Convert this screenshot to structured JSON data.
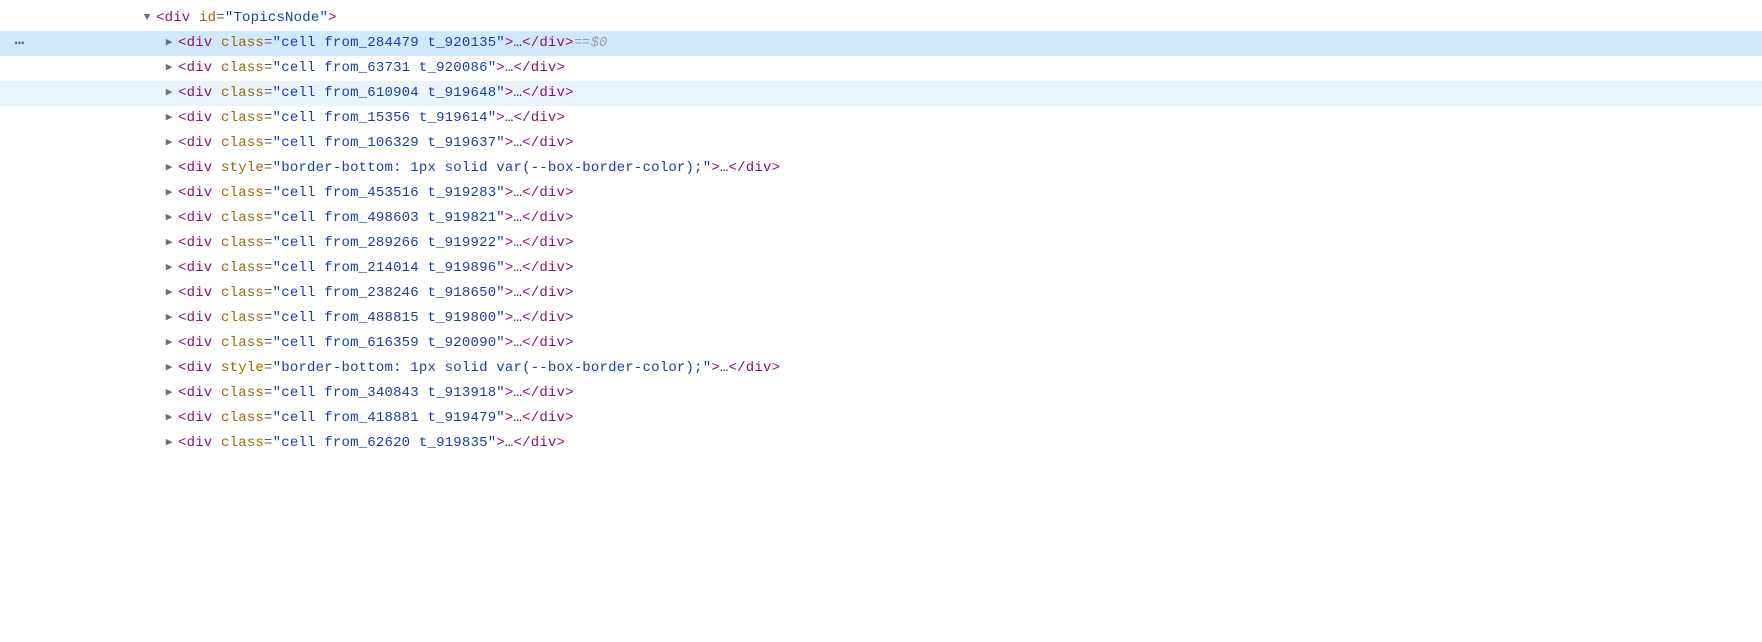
{
  "indent": {
    "base": 100,
    "step": 22
  },
  "glyphs": {
    "right": "▶",
    "down": "▼",
    "ellipsis": "…",
    "gutter_dots": "⋯"
  },
  "suffix": {
    "eqeq": " == ",
    "var": "$0"
  },
  "rows": [
    {
      "depth": 0,
      "arrow": "down",
      "state": "none",
      "gutter": false,
      "tokens": [
        {
          "t": "angle",
          "v": "<"
        },
        {
          "t": "tag",
          "v": "div"
        },
        {
          "t": "space"
        },
        {
          "t": "attr",
          "v": "id"
        },
        {
          "t": "eq",
          "v": "="
        },
        {
          "t": "str",
          "v": "\"TopicsNode\""
        },
        {
          "t": "angle",
          "v": ">"
        }
      ]
    },
    {
      "depth": 1,
      "arrow": "right",
      "state": "selected",
      "gutter": true,
      "suffix": true,
      "tokens": [
        {
          "t": "angle",
          "v": "<"
        },
        {
          "t": "tag",
          "v": "div"
        },
        {
          "t": "space"
        },
        {
          "t": "attr",
          "v": "class"
        },
        {
          "t": "eq",
          "v": "="
        },
        {
          "t": "str",
          "v": "\"cell from_284479 t_920135\""
        },
        {
          "t": "angle",
          "v": ">"
        },
        {
          "t": "ell"
        },
        {
          "t": "angle",
          "v": "</"
        },
        {
          "t": "tag",
          "v": "div"
        },
        {
          "t": "angle",
          "v": ">"
        }
      ]
    },
    {
      "depth": 1,
      "arrow": "right",
      "state": "none",
      "tokens": [
        {
          "t": "angle",
          "v": "<"
        },
        {
          "t": "tag",
          "v": "div"
        },
        {
          "t": "space"
        },
        {
          "t": "attr",
          "v": "class"
        },
        {
          "t": "eq",
          "v": "="
        },
        {
          "t": "str",
          "v": "\"cell from_63731 t_920086\""
        },
        {
          "t": "angle",
          "v": ">"
        },
        {
          "t": "ell"
        },
        {
          "t": "angle",
          "v": "</"
        },
        {
          "t": "tag",
          "v": "div"
        },
        {
          "t": "angle",
          "v": ">"
        }
      ]
    },
    {
      "depth": 1,
      "arrow": "right",
      "state": "hover",
      "tokens": [
        {
          "t": "angle",
          "v": "<"
        },
        {
          "t": "tag",
          "v": "div"
        },
        {
          "t": "space"
        },
        {
          "t": "attr",
          "v": "class"
        },
        {
          "t": "eq",
          "v": "="
        },
        {
          "t": "str",
          "v": "\"cell from_610904 t_919648\""
        },
        {
          "t": "angle",
          "v": ">"
        },
        {
          "t": "ell"
        },
        {
          "t": "angle",
          "v": "</"
        },
        {
          "t": "tag",
          "v": "div"
        },
        {
          "t": "angle",
          "v": ">"
        }
      ]
    },
    {
      "depth": 1,
      "arrow": "right",
      "state": "none",
      "tokens": [
        {
          "t": "angle",
          "v": "<"
        },
        {
          "t": "tag",
          "v": "div"
        },
        {
          "t": "space"
        },
        {
          "t": "attr",
          "v": "class"
        },
        {
          "t": "eq",
          "v": "="
        },
        {
          "t": "str",
          "v": "\"cell from_15356 t_919614\""
        },
        {
          "t": "angle",
          "v": ">"
        },
        {
          "t": "ell"
        },
        {
          "t": "angle",
          "v": "</"
        },
        {
          "t": "tag",
          "v": "div"
        },
        {
          "t": "angle",
          "v": ">"
        }
      ]
    },
    {
      "depth": 1,
      "arrow": "right",
      "state": "none",
      "tokens": [
        {
          "t": "angle",
          "v": "<"
        },
        {
          "t": "tag",
          "v": "div"
        },
        {
          "t": "space"
        },
        {
          "t": "attr",
          "v": "class"
        },
        {
          "t": "eq",
          "v": "="
        },
        {
          "t": "str",
          "v": "\"cell from_106329 t_919637\""
        },
        {
          "t": "angle",
          "v": ">"
        },
        {
          "t": "ell"
        },
        {
          "t": "angle",
          "v": "</"
        },
        {
          "t": "tag",
          "v": "div"
        },
        {
          "t": "angle",
          "v": ">"
        }
      ]
    },
    {
      "depth": 1,
      "arrow": "right",
      "state": "none",
      "tokens": [
        {
          "t": "angle",
          "v": "<"
        },
        {
          "t": "tag",
          "v": "div"
        },
        {
          "t": "space"
        },
        {
          "t": "attr",
          "v": "style"
        },
        {
          "t": "eq",
          "v": "="
        },
        {
          "t": "str",
          "v": "\"border-bottom: 1px solid var(--box-border-color);\""
        },
        {
          "t": "angle",
          "v": ">"
        },
        {
          "t": "ell"
        },
        {
          "t": "angle",
          "v": "</"
        },
        {
          "t": "tag",
          "v": "div"
        },
        {
          "t": "angle",
          "v": ">"
        }
      ]
    },
    {
      "depth": 1,
      "arrow": "right",
      "state": "none",
      "tokens": [
        {
          "t": "angle",
          "v": "<"
        },
        {
          "t": "tag",
          "v": "div"
        },
        {
          "t": "space"
        },
        {
          "t": "attr",
          "v": "class"
        },
        {
          "t": "eq",
          "v": "="
        },
        {
          "t": "str",
          "v": "\"cell from_453516 t_919283\""
        },
        {
          "t": "angle",
          "v": ">"
        },
        {
          "t": "ell"
        },
        {
          "t": "angle",
          "v": "</"
        },
        {
          "t": "tag",
          "v": "div"
        },
        {
          "t": "angle",
          "v": ">"
        }
      ]
    },
    {
      "depth": 1,
      "arrow": "right",
      "state": "none",
      "tokens": [
        {
          "t": "angle",
          "v": "<"
        },
        {
          "t": "tag",
          "v": "div"
        },
        {
          "t": "space"
        },
        {
          "t": "attr",
          "v": "class"
        },
        {
          "t": "eq",
          "v": "="
        },
        {
          "t": "str",
          "v": "\"cell from_498603 t_919821\""
        },
        {
          "t": "angle",
          "v": ">"
        },
        {
          "t": "ell"
        },
        {
          "t": "angle",
          "v": "</"
        },
        {
          "t": "tag",
          "v": "div"
        },
        {
          "t": "angle",
          "v": ">"
        }
      ]
    },
    {
      "depth": 1,
      "arrow": "right",
      "state": "none",
      "tokens": [
        {
          "t": "angle",
          "v": "<"
        },
        {
          "t": "tag",
          "v": "div"
        },
        {
          "t": "space"
        },
        {
          "t": "attr",
          "v": "class"
        },
        {
          "t": "eq",
          "v": "="
        },
        {
          "t": "str",
          "v": "\"cell from_289266 t_919922\""
        },
        {
          "t": "angle",
          "v": ">"
        },
        {
          "t": "ell"
        },
        {
          "t": "angle",
          "v": "</"
        },
        {
          "t": "tag",
          "v": "div"
        },
        {
          "t": "angle",
          "v": ">"
        }
      ]
    },
    {
      "depth": 1,
      "arrow": "right",
      "state": "none",
      "tokens": [
        {
          "t": "angle",
          "v": "<"
        },
        {
          "t": "tag",
          "v": "div"
        },
        {
          "t": "space"
        },
        {
          "t": "attr",
          "v": "class"
        },
        {
          "t": "eq",
          "v": "="
        },
        {
          "t": "str",
          "v": "\"cell from_214014 t_919896\""
        },
        {
          "t": "angle",
          "v": ">"
        },
        {
          "t": "ell"
        },
        {
          "t": "angle",
          "v": "</"
        },
        {
          "t": "tag",
          "v": "div"
        },
        {
          "t": "angle",
          "v": ">"
        }
      ]
    },
    {
      "depth": 1,
      "arrow": "right",
      "state": "none",
      "tokens": [
        {
          "t": "angle",
          "v": "<"
        },
        {
          "t": "tag",
          "v": "div"
        },
        {
          "t": "space"
        },
        {
          "t": "attr",
          "v": "class"
        },
        {
          "t": "eq",
          "v": "="
        },
        {
          "t": "str",
          "v": "\"cell from_238246 t_918650\""
        },
        {
          "t": "angle",
          "v": ">"
        },
        {
          "t": "ell"
        },
        {
          "t": "angle",
          "v": "</"
        },
        {
          "t": "tag",
          "v": "div"
        },
        {
          "t": "angle",
          "v": ">"
        }
      ]
    },
    {
      "depth": 1,
      "arrow": "right",
      "state": "none",
      "tokens": [
        {
          "t": "angle",
          "v": "<"
        },
        {
          "t": "tag",
          "v": "div"
        },
        {
          "t": "space"
        },
        {
          "t": "attr",
          "v": "class"
        },
        {
          "t": "eq",
          "v": "="
        },
        {
          "t": "str",
          "v": "\"cell from_488815 t_919800\""
        },
        {
          "t": "angle",
          "v": ">"
        },
        {
          "t": "ell"
        },
        {
          "t": "angle",
          "v": "</"
        },
        {
          "t": "tag",
          "v": "div"
        },
        {
          "t": "angle",
          "v": ">"
        }
      ]
    },
    {
      "depth": 1,
      "arrow": "right",
      "state": "none",
      "tokens": [
        {
          "t": "angle",
          "v": "<"
        },
        {
          "t": "tag",
          "v": "div"
        },
        {
          "t": "space"
        },
        {
          "t": "attr",
          "v": "class"
        },
        {
          "t": "eq",
          "v": "="
        },
        {
          "t": "str",
          "v": "\"cell from_616359 t_920090\""
        },
        {
          "t": "angle",
          "v": ">"
        },
        {
          "t": "ell"
        },
        {
          "t": "angle",
          "v": "</"
        },
        {
          "t": "tag",
          "v": "div"
        },
        {
          "t": "angle",
          "v": ">"
        }
      ]
    },
    {
      "depth": 1,
      "arrow": "right",
      "state": "none",
      "tokens": [
        {
          "t": "angle",
          "v": "<"
        },
        {
          "t": "tag",
          "v": "div"
        },
        {
          "t": "space"
        },
        {
          "t": "attr",
          "v": "style"
        },
        {
          "t": "eq",
          "v": "="
        },
        {
          "t": "str",
          "v": "\"border-bottom: 1px solid var(--box-border-color);\""
        },
        {
          "t": "angle",
          "v": ">"
        },
        {
          "t": "ell"
        },
        {
          "t": "angle",
          "v": "</"
        },
        {
          "t": "tag",
          "v": "div"
        },
        {
          "t": "angle",
          "v": ">"
        }
      ]
    },
    {
      "depth": 1,
      "arrow": "right",
      "state": "none",
      "tokens": [
        {
          "t": "angle",
          "v": "<"
        },
        {
          "t": "tag",
          "v": "div"
        },
        {
          "t": "space"
        },
        {
          "t": "attr",
          "v": "class"
        },
        {
          "t": "eq",
          "v": "="
        },
        {
          "t": "str",
          "v": "\"cell from_340843 t_913918\""
        },
        {
          "t": "angle",
          "v": ">"
        },
        {
          "t": "ell"
        },
        {
          "t": "angle",
          "v": "</"
        },
        {
          "t": "tag",
          "v": "div"
        },
        {
          "t": "angle",
          "v": ">"
        }
      ]
    },
    {
      "depth": 1,
      "arrow": "right",
      "state": "none",
      "tokens": [
        {
          "t": "angle",
          "v": "<"
        },
        {
          "t": "tag",
          "v": "div"
        },
        {
          "t": "space"
        },
        {
          "t": "attr",
          "v": "class"
        },
        {
          "t": "eq",
          "v": "="
        },
        {
          "t": "str",
          "v": "\"cell from_418881 t_919479\""
        },
        {
          "t": "angle",
          "v": ">"
        },
        {
          "t": "ell"
        },
        {
          "t": "angle",
          "v": "</"
        },
        {
          "t": "tag",
          "v": "div"
        },
        {
          "t": "angle",
          "v": ">"
        }
      ]
    },
    {
      "depth": 1,
      "arrow": "right",
      "state": "none",
      "tokens": [
        {
          "t": "angle",
          "v": "<"
        },
        {
          "t": "tag",
          "v": "div"
        },
        {
          "t": "space"
        },
        {
          "t": "attr",
          "v": "class"
        },
        {
          "t": "eq",
          "v": "="
        },
        {
          "t": "str",
          "v": "\"cell from_62620 t_919835\""
        },
        {
          "t": "angle",
          "v": ">"
        },
        {
          "t": "ell"
        },
        {
          "t": "angle",
          "v": "</"
        },
        {
          "t": "tag",
          "v": "div"
        },
        {
          "t": "angle",
          "v": ">"
        }
      ]
    }
  ]
}
